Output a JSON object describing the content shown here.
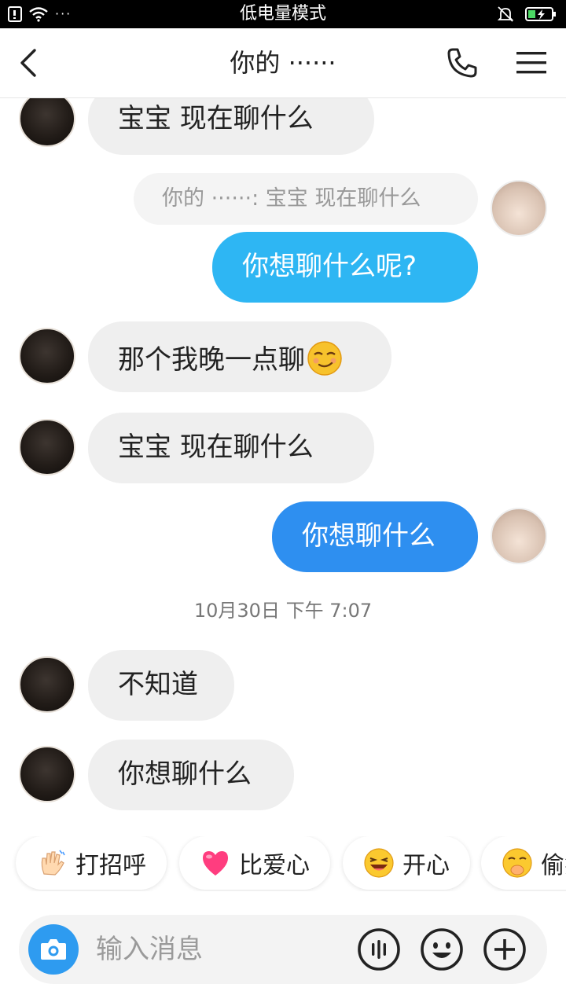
{
  "status_bar": {
    "title": "低电量模式",
    "dots": "···"
  },
  "header": {
    "title": "你的 ······",
    "icons": [
      "back-icon",
      "phone-icon",
      "menu-icon"
    ]
  },
  "messages": [
    {
      "side": "in",
      "text": "宝宝   现在聊什么"
    },
    {
      "side": "quote",
      "text": "你的 ······: 宝宝   现在聊什么"
    },
    {
      "side": "out",
      "text": "你想聊什么呢?"
    },
    {
      "side": "in",
      "text": "那个我晚一点聊"
    },
    {
      "side": "in",
      "text": "宝宝   现在聊什么"
    },
    {
      "side": "out",
      "text": "你想聊什么"
    },
    {
      "side": "in",
      "text": "不知道"
    },
    {
      "side": "in",
      "text": "你想聊什么"
    }
  ],
  "timestamp": "10月30日 下午 7:07",
  "quick_replies": [
    {
      "label": "打招呼",
      "icon": "wave-hand-icon"
    },
    {
      "label": "比爱心",
      "icon": "heart-icon"
    },
    {
      "label": "开心",
      "icon": "laughing-face-icon"
    },
    {
      "label": "偷笑",
      "icon": "giggle-face-icon"
    }
  ],
  "input": {
    "placeholder": "输入消息"
  },
  "colors": {
    "outgoing_bubble": "#2eb6f3",
    "outgoing_bubble_2": "#2e8ff0",
    "incoming_bubble": "#efefef",
    "camera_button": "#2e9bf0"
  }
}
